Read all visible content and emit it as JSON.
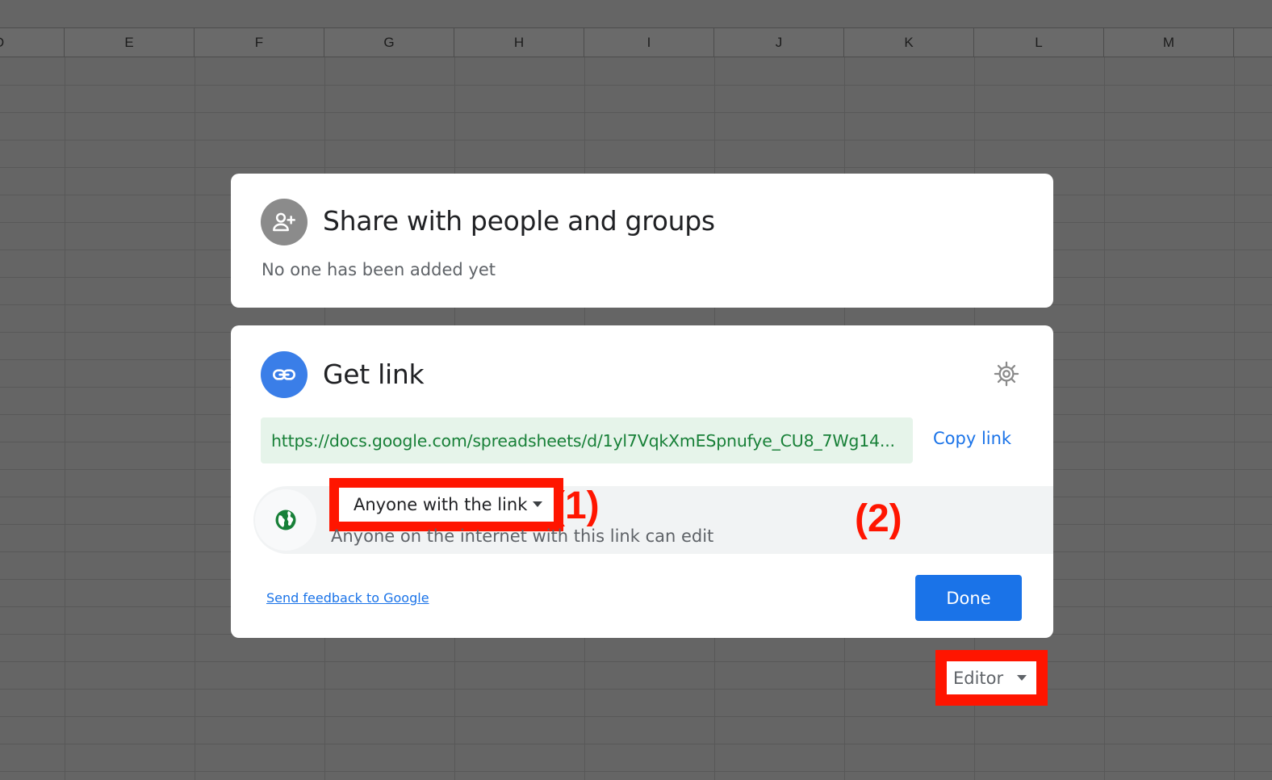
{
  "spreadsheet": {
    "column_headers": [
      "D",
      "E",
      "F",
      "G",
      "H",
      "I",
      "J",
      "K",
      "L",
      "M"
    ]
  },
  "share_card": {
    "title": "Share with people and groups",
    "subtitle": "No one has been added yet",
    "icon": "person-add-icon"
  },
  "link_card": {
    "title": "Get link",
    "icon": "link-icon",
    "settings_icon": "gear-icon",
    "url": "https://docs.google.com/spreadsheets/d/1yl7VqkXmESpnufye_CU8_7Wg14...",
    "copy_label": "Copy link",
    "access": {
      "icon": "globe-icon",
      "selected": "Anyone with the link",
      "description": "Anyone on the internet with this link can edit"
    },
    "role": {
      "selected": "Editor"
    },
    "feedback_label": "Send feedback to Google",
    "done_label": "Done"
  },
  "annotations": {
    "step_1": "(1)",
    "step_2": "(2)"
  },
  "colors": {
    "accent": "#1a73e8",
    "link_green": "#188038",
    "link_bg": "#e6f4ea",
    "annotation_red": "#ff1500",
    "overlay": "#656565"
  }
}
